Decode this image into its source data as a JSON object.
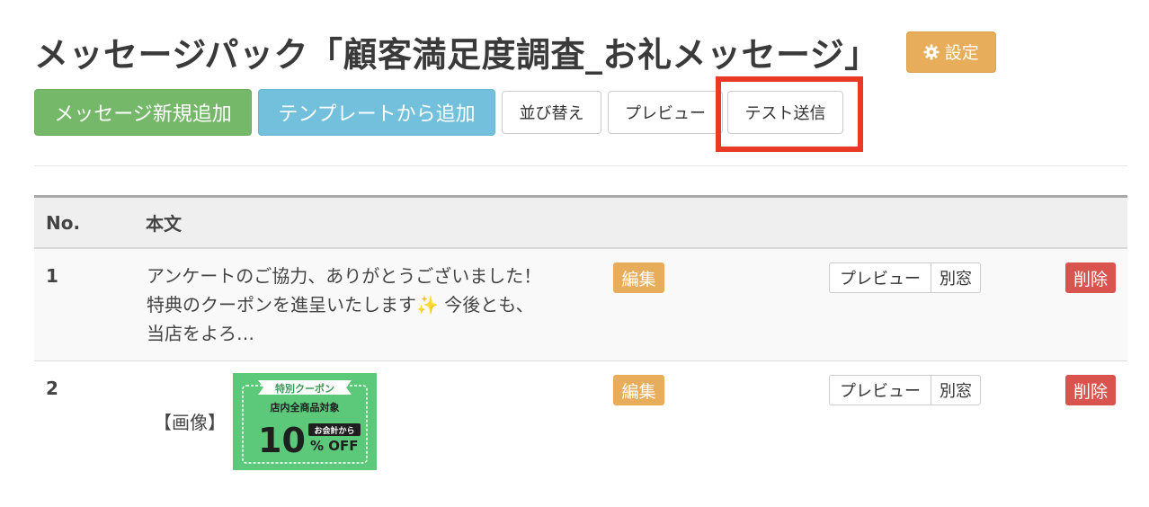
{
  "header": {
    "title": "メッセージパック「顧客満足度調査_お礼メッセージ」",
    "settings_label": "設定"
  },
  "toolbar": {
    "add_message": "メッセージ新規追加",
    "add_from_template": "テンプレートから追加",
    "sort": "並び替え",
    "preview": "プレビュー",
    "test_send": "テスト送信"
  },
  "table": {
    "columns": [
      "No.",
      "本文"
    ],
    "rows": [
      {
        "no": "1",
        "text_line1": "アンケートのご協力、ありがとうございました！",
        "text_line2a": "特典のクーポンを進呈いたします",
        "sparkle": "✨",
        "text_line2b": " 今後とも、",
        "text_line3": "当店をよろ…",
        "edit": "編集",
        "preview": "プレビュー",
        "new_window": "別窓",
        "delete": "削除"
      },
      {
        "no": "2",
        "image_label": "【画像】",
        "edit": "編集",
        "preview": "プレビュー",
        "new_window": "別窓",
        "delete": "削除"
      }
    ]
  },
  "coupon": {
    "ribbon": "特別クーポン",
    "subtitle": "店内全商品対象",
    "number": "10",
    "tag": "お会計から",
    "percent": "% OFF"
  },
  "colors": {
    "primary_green": "#76b86a",
    "info_blue": "#72c0dc",
    "warning_orange": "#e8ad5b",
    "danger_red": "#d9534f",
    "highlight_red": "#e83a25"
  }
}
